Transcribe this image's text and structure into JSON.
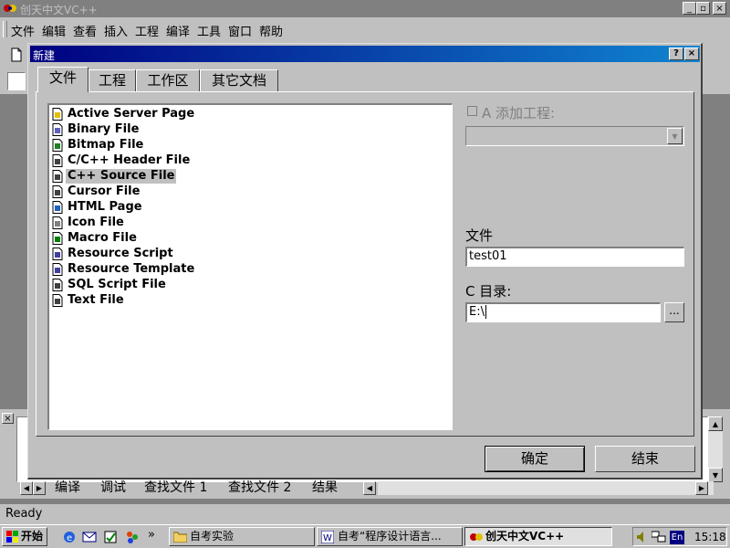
{
  "window": {
    "title": "创天中文VC++",
    "min": "_",
    "max": "▫",
    "close": "×"
  },
  "menu": [
    "文件",
    "编辑",
    "查看",
    "插入",
    "工程",
    "编译",
    "工具",
    "窗口",
    "帮助"
  ],
  "dialog": {
    "title": "新建",
    "help_btn": "?",
    "close_btn": "×",
    "tabs": [
      "文件",
      "工程",
      "工作区",
      "其它文档"
    ],
    "files": [
      "Active Server Page",
      "Binary File",
      "Bitmap File",
      "C/C++ Header File",
      "C++ Source File",
      "Cursor File",
      "HTML Page",
      "Icon File",
      "Macro File",
      "Resource Script",
      "Resource Template",
      "SQL Script File",
      "Text File"
    ],
    "selected_file": "C++ Source File",
    "add_to_project": {
      "label": "A 添加工程:",
      "checked": false
    },
    "project_combo": "",
    "file_label": "文件",
    "file_value": "test01",
    "dir_label": "C 目录:",
    "dir_value": "E:\\",
    "browse": "...",
    "ok": "确定",
    "cancel": "结束"
  },
  "output_tabs": [
    "编译",
    "调试",
    "查找文件 1",
    "查找文件 2",
    "结果"
  ],
  "status": "Ready",
  "taskbar": {
    "start": "开始",
    "quick_more": "»",
    "tasks": [
      "自考实验",
      "自考“程序设计语言...",
      "创天中文VC++"
    ],
    "lang": "En",
    "clock": "15:18"
  }
}
